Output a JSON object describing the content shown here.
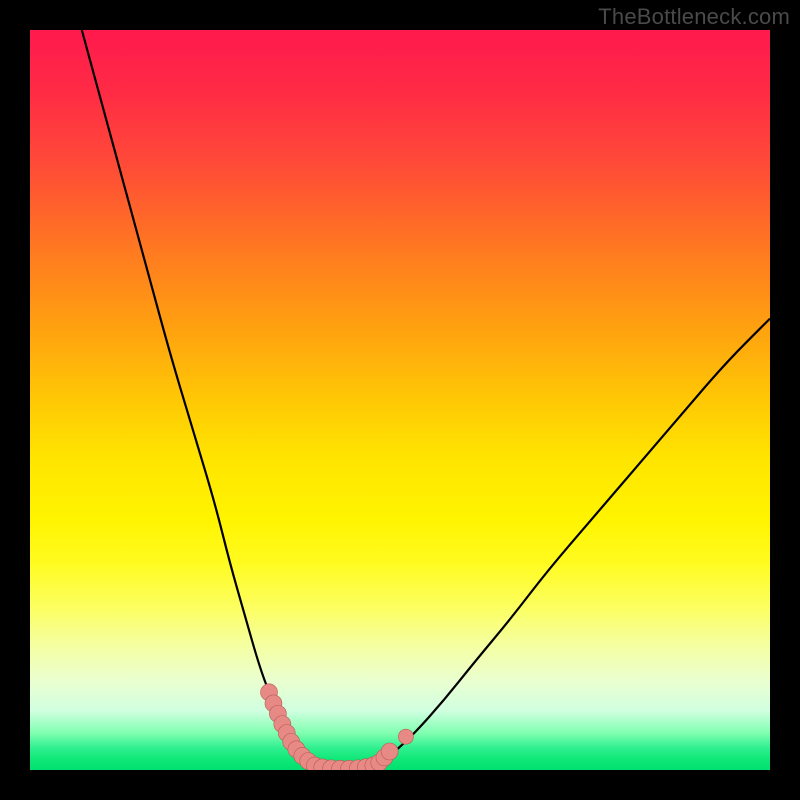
{
  "watermark": "TheBottleneck.com",
  "colors": {
    "frame": "#000000",
    "curve": "#000000",
    "marker_fill": "#e78a86",
    "marker_stroke": "#b95a56"
  },
  "chart_data": {
    "type": "line",
    "title": "",
    "xlabel": "",
    "ylabel": "",
    "xlim": [
      0,
      100
    ],
    "ylim": [
      0,
      100
    ],
    "grid": false,
    "legend": false,
    "note": "Values are read off pixel positions; chart has no numeric axis labels so x/y are normalized 0–100 within the plot area. y≈0 corresponds to the green band (good), y≈100 to the red top (bad).",
    "series": [
      {
        "name": "left-branch",
        "x": [
          7,
          10,
          13,
          16,
          19,
          22,
          25,
          27,
          29,
          31,
          32.5,
          34,
          35.5,
          37,
          38
        ],
        "y": [
          100,
          89,
          78,
          67,
          56,
          46,
          36,
          28,
          21,
          14,
          10,
          6.5,
          3.8,
          1.8,
          0.5
        ]
      },
      {
        "name": "right-branch",
        "x": [
          47,
          49,
          52,
          56,
          60,
          65,
          70,
          76,
          82,
          88,
          94,
          100
        ],
        "y": [
          0.8,
          2.2,
          5,
          9.5,
          14.5,
          20.5,
          27,
          34,
          41,
          48,
          55,
          61
        ]
      }
    ],
    "valley_segment": {
      "name": "valley-flat",
      "x": [
        38,
        40,
        43,
        45,
        47
      ],
      "y": [
        0.5,
        0.2,
        0.15,
        0.2,
        0.8
      ]
    },
    "markers_left": [
      {
        "x": 32.3,
        "y": 10.5
      },
      {
        "x": 32.9,
        "y": 9.0
      },
      {
        "x": 33.5,
        "y": 7.6
      },
      {
        "x": 34.1,
        "y": 6.2
      },
      {
        "x": 34.7,
        "y": 5.0
      },
      {
        "x": 35.3,
        "y": 3.8
      },
      {
        "x": 36.0,
        "y": 2.8
      },
      {
        "x": 36.8,
        "y": 1.9
      },
      {
        "x": 37.6,
        "y": 1.2
      }
    ],
    "markers_bottom": [
      {
        "x": 38.5,
        "y": 0.6
      },
      {
        "x": 39.5,
        "y": 0.35
      },
      {
        "x": 40.7,
        "y": 0.22
      },
      {
        "x": 41.9,
        "y": 0.16
      },
      {
        "x": 43.1,
        "y": 0.16
      },
      {
        "x": 44.3,
        "y": 0.22
      },
      {
        "x": 45.4,
        "y": 0.38
      },
      {
        "x": 46.4,
        "y": 0.62
      }
    ],
    "markers_right": [
      {
        "x": 47.2,
        "y": 1.0
      },
      {
        "x": 47.9,
        "y": 1.7
      },
      {
        "x": 48.6,
        "y": 2.5
      }
    ],
    "markers_right_isolated": [
      {
        "x": 50.8,
        "y": 4.5
      }
    ]
  }
}
